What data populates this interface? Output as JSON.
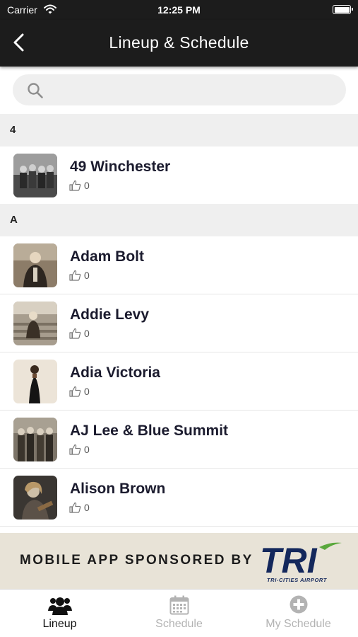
{
  "status_bar": {
    "carrier": "Carrier",
    "time": "12:25 PM"
  },
  "nav": {
    "title": "Lineup & Schedule"
  },
  "search": {
    "placeholder": ""
  },
  "sections": [
    {
      "header": "4",
      "items": [
        {
          "name": "49 Winchester",
          "likes": "0"
        }
      ]
    },
    {
      "header": "A",
      "items": [
        {
          "name": "Adam Bolt",
          "likes": "0"
        },
        {
          "name": "Addie Levy",
          "likes": "0"
        },
        {
          "name": "Adia Victoria",
          "likes": "0"
        },
        {
          "name": "AJ Lee & Blue Summit",
          "likes": "0"
        },
        {
          "name": "Alison Brown",
          "likes": "0"
        }
      ]
    }
  ],
  "sponsor": {
    "text": "MOBILE APP SPONSORED BY",
    "logo_text": "TRI",
    "logo_subtext": "TRI-CITIES AIRPORT"
  },
  "tabs": [
    {
      "label": "Lineup",
      "icon": "users-icon",
      "active": true
    },
    {
      "label": "Schedule",
      "icon": "calendar-icon",
      "active": false
    },
    {
      "label": "My Schedule",
      "icon": "plus-circle-icon",
      "active": false
    }
  ],
  "colors": {
    "header_bg": "#1c1c1c",
    "section_bg": "#efefef",
    "banner_bg": "#e8e3d7",
    "logo_navy": "#14285c",
    "logo_green": "#5aa83c",
    "tab_inactive": "#b3b3b3"
  }
}
